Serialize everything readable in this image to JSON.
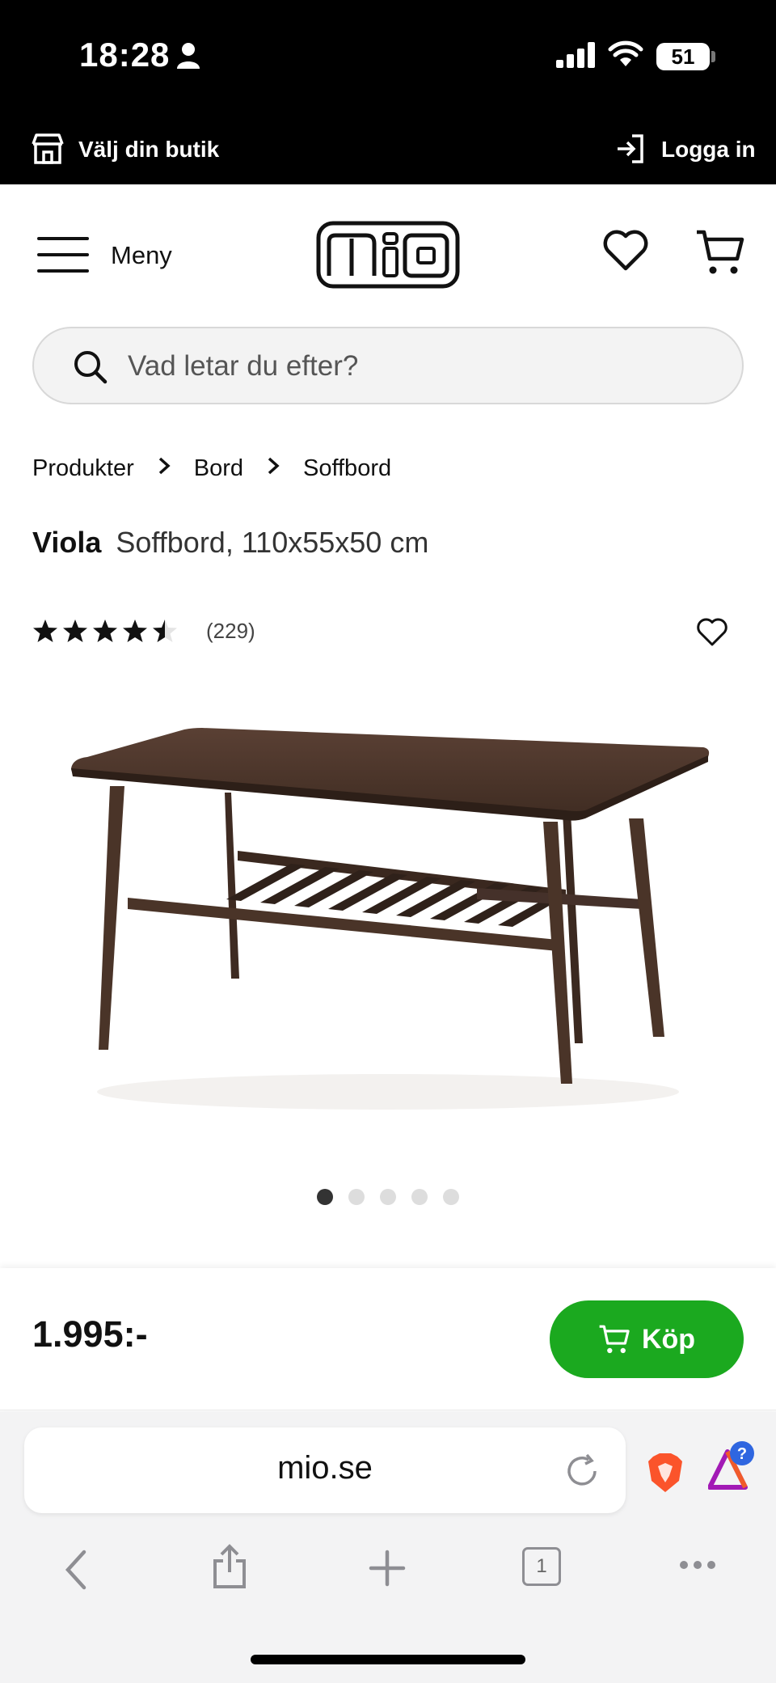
{
  "status_bar": {
    "time": "18:28",
    "battery": "51"
  },
  "store_bar": {
    "store_label": "Välj din butik",
    "login_label": "Logga in"
  },
  "header": {
    "menu_label": "Meny",
    "logo_text": "mio"
  },
  "search": {
    "placeholder": "Vad letar du efter?"
  },
  "breadcrumb": [
    "Produkter",
    "Bord",
    "Soffbord"
  ],
  "product": {
    "name": "Viola",
    "description": "Soffbord, 110x55x50 cm",
    "rating": 4.5,
    "rating_max": 5,
    "review_count": "(229)",
    "image_count": 5,
    "active_image": 1,
    "price": "1.995:-",
    "buy_label": "Köp"
  },
  "browser": {
    "url": "mio.se",
    "tab_count": "1"
  },
  "colors": {
    "buy_green": "#1ba91f",
    "topbar": "#000000",
    "wood": "#4a3428"
  }
}
